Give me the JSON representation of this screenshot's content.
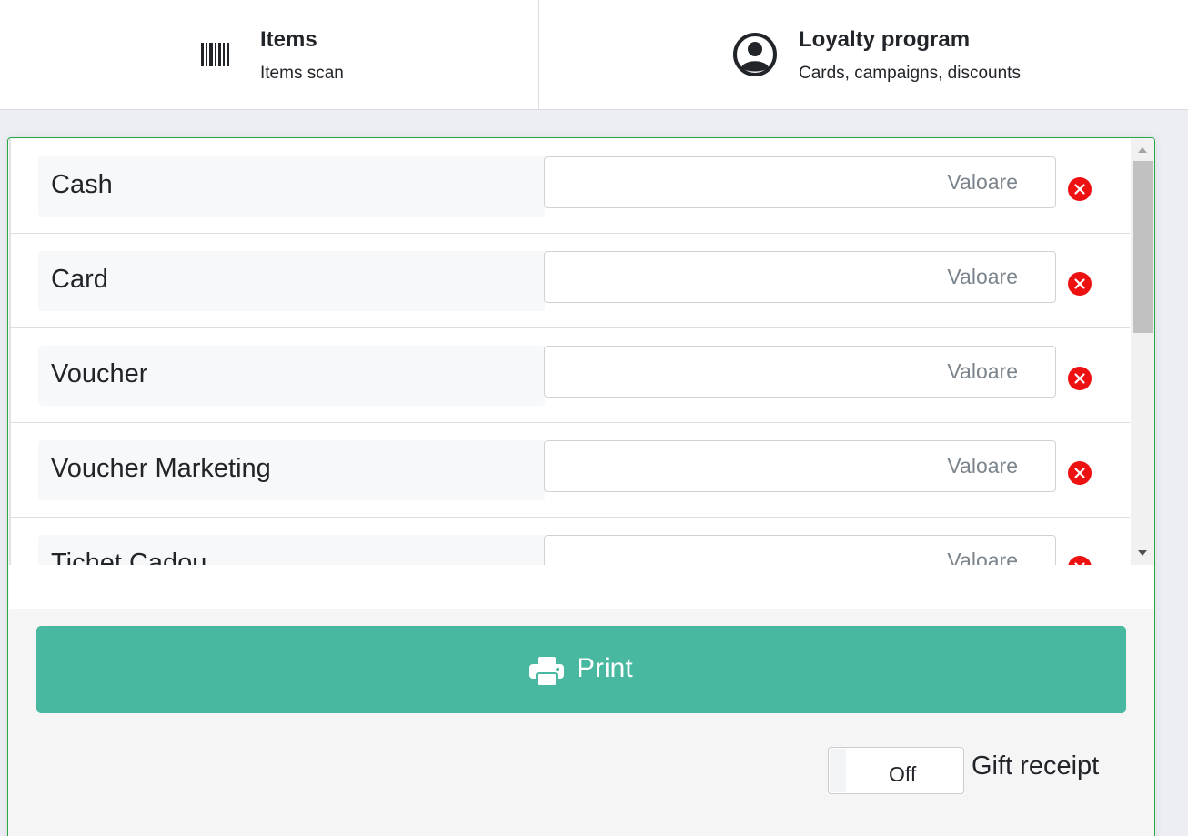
{
  "nav": {
    "items": {
      "title": "Items",
      "subtitle": "Items scan",
      "icon": "barcode-icon"
    },
    "loyalty": {
      "title": "Loyalty program",
      "subtitle": "Cards, campaigns, discounts",
      "icon": "user-circle-icon"
    }
  },
  "payments": {
    "placeholder": "Valoare",
    "methods": [
      {
        "label": "Cash",
        "value": ""
      },
      {
        "label": "Card",
        "value": ""
      },
      {
        "label": "Voucher",
        "value": ""
      },
      {
        "label": "Voucher Marketing",
        "value": ""
      },
      {
        "label": "Tichet Cadou",
        "value": ""
      }
    ],
    "remove_icon": "close-circle-icon"
  },
  "print_button": {
    "label": "Print",
    "icon": "printer-icon"
  },
  "gift_receipt": {
    "toggle_state": "Off",
    "label": "Gift receipt"
  },
  "colors": {
    "accent": "#48b9a0",
    "danger": "#ee1111",
    "panel_border": "#28a745"
  }
}
